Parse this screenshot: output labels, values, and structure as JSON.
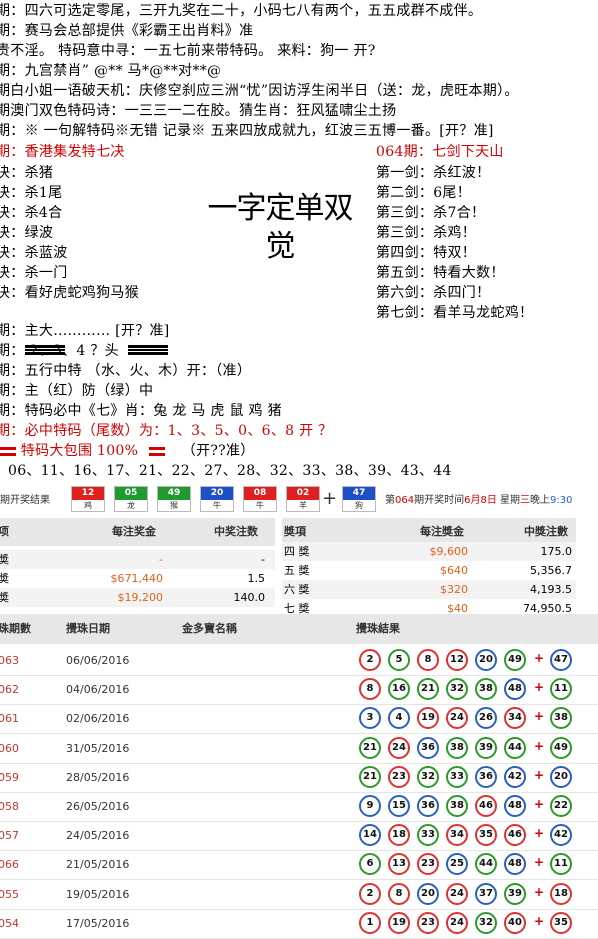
{
  "header_lines": [
    "期：四六可选定零尾，三开九奖在二十，小码七八有两个，五五成群不成伴。",
    "期：赛马会总部提供《彩霸王出肖料》准",
    "贵不淫。 特码意中寻：一五七前来带特码。 来料：狗一 开?",
    "期：九宫禁肖” @** 马*@**对**@",
    "期白小姐一语破天机：庆修空刹应三洲“忧”因访浮生闲半日（送：龙，虎旺本期）。",
    "期澳门双色特码诗：一三三一二在胶。猜生肖：狂风猛啸尘土扬",
    "期：※ 一句解特码※无错 记录※ 五来四放成就九，红波三五博一番。[开？准]"
  ],
  "left_title": "期：香港集发特七决",
  "left_items": [
    "决：杀猪",
    "决：杀1尾",
    "决：杀4合",
    "决：绿波",
    "决：杀蓝波",
    "决：杀一门",
    "决：看好虎蛇鸡狗马猴"
  ],
  "center_title": "一字定单双 觉",
  "right_title": "064期：七剑下天山",
  "right_items": [
    "第一剑：杀红波！",
    "第二剑：6尾！",
    "第三剑：杀7合！",
    "第三剑：杀鸡！",
    "第四剑：特双！",
    "第五剑：特看大数！",
    "第六剑：杀四门！",
    "第七剑：看羊马龙蛇鸡！"
  ],
  "lower_lines": [
    "期：主大………… [开？准]",
    "期： 2、3、4 ？头",
    "期：五行中特 （水、火、木）开：（准）",
    "期：主（红）防（绿）中",
    "期：特码必中《七》肖：兔 龙 马 虎 鼠 鸡  猪",
    "期：必中特码（尾数）为：1、3、5、0、6、8     开 ？",
    "特码大包围 100%",
    "（开??准）",
    "06、11、16、17、21、22、27、28、32、33、38、39、43、44"
  ],
  "strip": {
    "label": "期开奖结果",
    "balls": [
      {
        "n": "12",
        "z": "鸡",
        "color": "#e02020"
      },
      {
        "n": "05",
        "z": "龙",
        "color": "#1f9a2f"
      },
      {
        "n": "49",
        "z": "猴",
        "color": "#1f9a2f"
      },
      {
        "n": "20",
        "z": "牛",
        "color": "#1c4fc8"
      },
      {
        "n": "08",
        "z": "牛",
        "color": "#e02020"
      },
      {
        "n": "02",
        "z": "羊",
        "color": "#e02020"
      },
      {
        "n": "47",
        "z": "狗",
        "color": "#1c4fc8"
      }
    ],
    "plus": "+",
    "info_pre": "第",
    "info_draw": "064",
    "info_mid": "期开奖时间",
    "info_date": "6月8日",
    "info_week": " 星期",
    "info_day": "三",
    "info_night": "晚上",
    "info_time": "9:30"
  },
  "prize_left": {
    "headers": [
      "项",
      "每注奖金",
      "中奖注数"
    ],
    "rows": [
      {
        "name": "奬",
        "amount": "-",
        "count": "-"
      },
      {
        "name": "奬",
        "amount": "$671,440",
        "count": "1.5"
      },
      {
        "name": "奬",
        "amount": "$19,200",
        "count": "140.0"
      }
    ]
  },
  "prize_right": {
    "headers": [
      "獎項",
      "每注獎金",
      "中獎注數"
    ],
    "rows": [
      {
        "name": "四 獎",
        "amount": "$9,600",
        "count": "175.0"
      },
      {
        "name": "五 獎",
        "amount": "$640",
        "count": "5,356.7"
      },
      {
        "name": "六 獎",
        "amount": "$320",
        "count": "4,193.5"
      },
      {
        "name": "七 獎",
        "amount": "$40",
        "count": "74,950.5"
      }
    ]
  },
  "history": {
    "headers": [
      "珠期數",
      "攪珠日期",
      "金多寶名稱",
      "攪珠結果"
    ],
    "rows": [
      {
        "no": "063",
        "date": "06/06/2016",
        "balls": [
          [
            "2",
            "red"
          ],
          [
            "5",
            "green"
          ],
          [
            "8",
            "red"
          ],
          [
            "12",
            "red"
          ],
          [
            "20",
            "blue"
          ],
          [
            "49",
            "green"
          ]
        ],
        "extra": [
          "47",
          "blue"
        ]
      },
      {
        "no": "062",
        "date": "04/06/2016",
        "balls": [
          [
            "8",
            "red"
          ],
          [
            "16",
            "green"
          ],
          [
            "21",
            "green"
          ],
          [
            "32",
            "green"
          ],
          [
            "38",
            "green"
          ],
          [
            "48",
            "blue"
          ]
        ],
        "extra": [
          "11",
          "green"
        ]
      },
      {
        "no": "061",
        "date": "02/06/2016",
        "balls": [
          [
            "3",
            "blue"
          ],
          [
            "4",
            "blue"
          ],
          [
            "19",
            "red"
          ],
          [
            "24",
            "red"
          ],
          [
            "26",
            "blue"
          ],
          [
            "34",
            "red"
          ]
        ],
        "extra": [
          "38",
          "green"
        ]
      },
      {
        "no": "060",
        "date": "31/05/2016",
        "balls": [
          [
            "21",
            "green"
          ],
          [
            "24",
            "red"
          ],
          [
            "36",
            "blue"
          ],
          [
            "38",
            "green"
          ],
          [
            "39",
            "green"
          ],
          [
            "44",
            "green"
          ]
        ],
        "extra": [
          "49",
          "green"
        ]
      },
      {
        "no": "059",
        "date": "28/05/2016",
        "balls": [
          [
            "21",
            "green"
          ],
          [
            "23",
            "red"
          ],
          [
            "32",
            "green"
          ],
          [
            "33",
            "green"
          ],
          [
            "36",
            "blue"
          ],
          [
            "42",
            "blue"
          ]
        ],
        "extra": [
          "20",
          "blue"
        ]
      },
      {
        "no": "058",
        "date": "26/05/2016",
        "balls": [
          [
            "9",
            "blue"
          ],
          [
            "15",
            "blue"
          ],
          [
            "36",
            "blue"
          ],
          [
            "38",
            "green"
          ],
          [
            "46",
            "red"
          ],
          [
            "48",
            "blue"
          ]
        ],
        "extra": [
          "22",
          "green"
        ]
      },
      {
        "no": "057",
        "date": "24/05/2016",
        "balls": [
          [
            "14",
            "blue"
          ],
          [
            "18",
            "red"
          ],
          [
            "33",
            "green"
          ],
          [
            "34",
            "red"
          ],
          [
            "35",
            "red"
          ],
          [
            "46",
            "red"
          ]
        ],
        "extra": [
          "42",
          "blue"
        ]
      },
      {
        "no": "066",
        "date": "21/05/2016",
        "balls": [
          [
            "6",
            "green"
          ],
          [
            "13",
            "red"
          ],
          [
            "23",
            "red"
          ],
          [
            "25",
            "blue"
          ],
          [
            "44",
            "green"
          ],
          [
            "48",
            "blue"
          ]
        ],
        "extra": [
          "11",
          "green"
        ]
      },
      {
        "no": "055",
        "date": "19/05/2016",
        "balls": [
          [
            "2",
            "red"
          ],
          [
            "8",
            "red"
          ],
          [
            "20",
            "blue"
          ],
          [
            "24",
            "red"
          ],
          [
            "37",
            "blue"
          ],
          [
            "39",
            "green"
          ]
        ],
        "extra": [
          "18",
          "red"
        ]
      },
      {
        "no": "054",
        "date": "17/05/2016",
        "balls": [
          [
            "1",
            "red"
          ],
          [
            "19",
            "red"
          ],
          [
            "23",
            "red"
          ],
          [
            "24",
            "red"
          ],
          [
            "32",
            "green"
          ],
          [
            "40",
            "red"
          ]
        ],
        "extra": [
          "35",
          "red"
        ]
      }
    ]
  }
}
